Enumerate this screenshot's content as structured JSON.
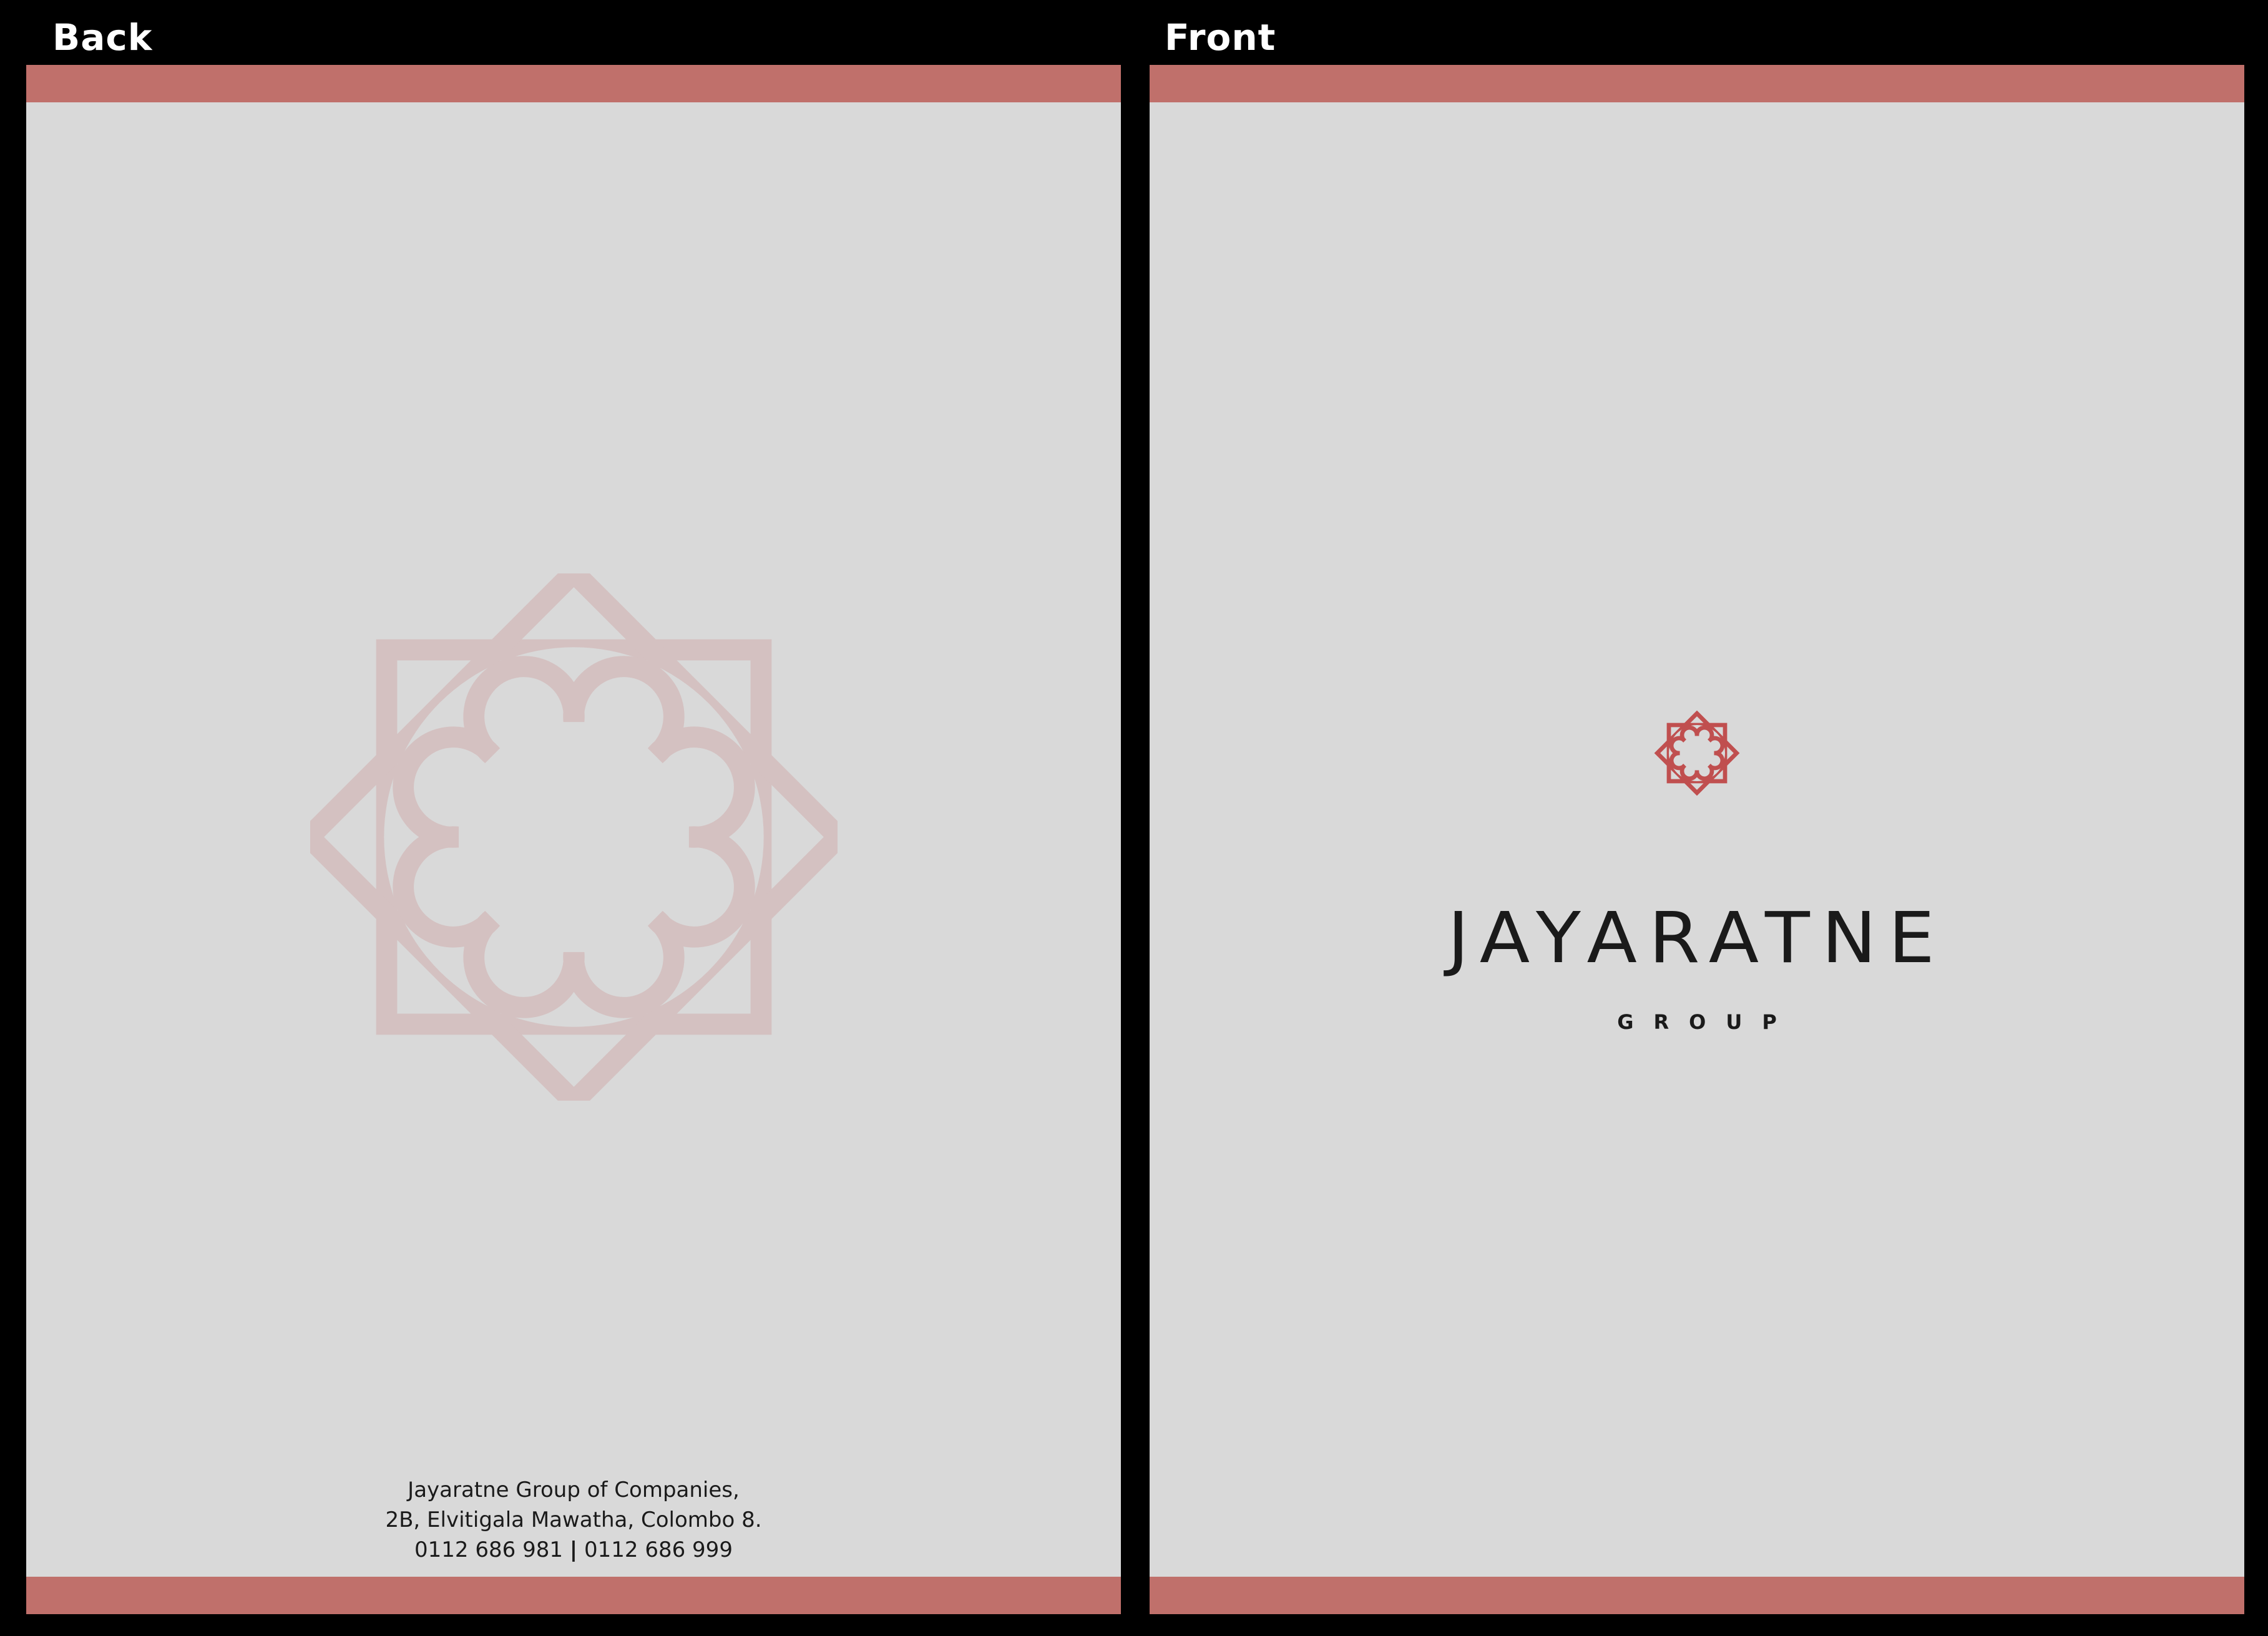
{
  "colors": {
    "background": "#000000",
    "panel": "#d9d9d9",
    "band": "#c0706b",
    "emblem_faded": "#d4c1c1",
    "emblem_front": "#c04f4f",
    "text": "#1a1a1a",
    "label": "#ffffff"
  },
  "back": {
    "label": "Back",
    "emblem_icon": "eight-point-star-emblem-icon",
    "address": {
      "line1": "Jayaratne Group of Companies,",
      "line2": "2B, Elvitigala Mawatha, Colombo 8.",
      "phone1": "0112 686 981",
      "separator": "|",
      "phone2": "0112 686 999"
    }
  },
  "front": {
    "label": "Front",
    "emblem_icon": "eight-point-star-emblem-icon",
    "wordmark": "JAYARATNE",
    "subtitle": "GROUP"
  }
}
